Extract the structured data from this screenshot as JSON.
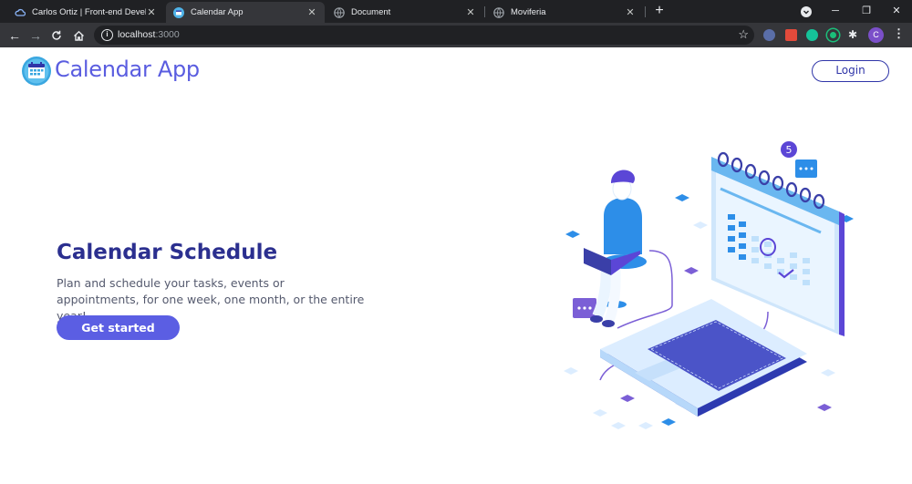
{
  "browser": {
    "tabs": [
      {
        "title": "Carlos Ortiz | Front-end Developer",
        "active": false
      },
      {
        "title": "Calendar App",
        "active": true
      },
      {
        "title": "Document",
        "active": false
      },
      {
        "title": "Moviferia",
        "active": false
      }
    ],
    "url_host": "localhost",
    "url_port": ":3000",
    "profile_initial": "C"
  },
  "header": {
    "brand": "Calendar App",
    "login_label": "Login"
  },
  "hero": {
    "title": "Calendar Schedule",
    "description": "Plan and schedule your tasks, events or appointments, for one week, one month, or the entire year!",
    "cta_label": "Get started",
    "illustration_badge": "5"
  },
  "colors": {
    "brand": "#5a5de0",
    "title": "#2b2f8f",
    "cta": "#5b5ee3",
    "accent_light": "#dcedff",
    "accent_blue": "#2d8ee8"
  }
}
